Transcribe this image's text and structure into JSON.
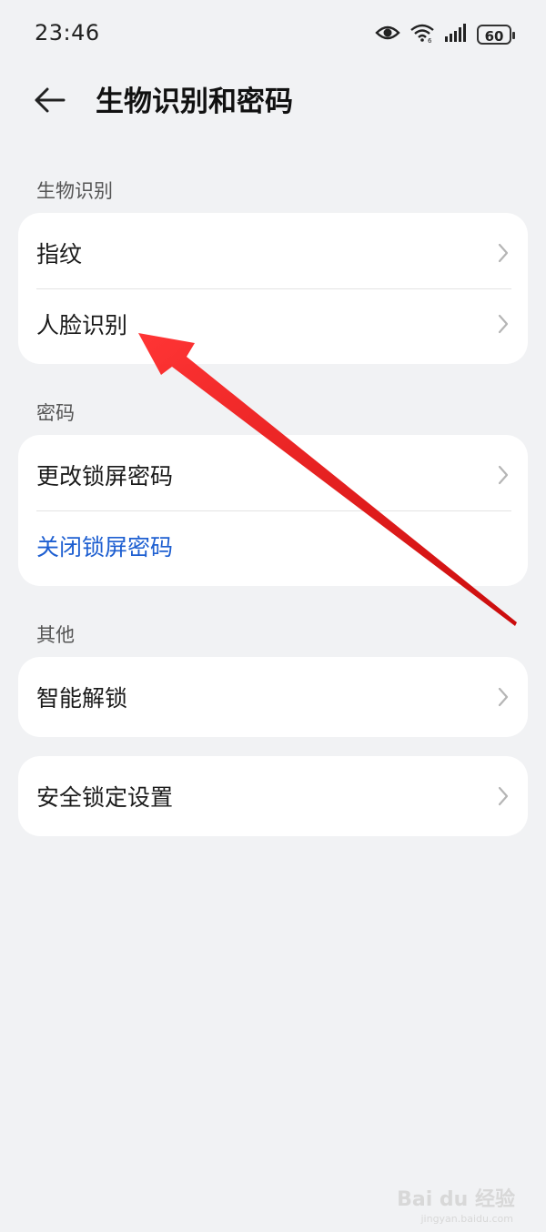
{
  "status_bar": {
    "time": "23:46",
    "battery": "60",
    "icons": [
      "eye-icon",
      "wifi-icon",
      "signal-icon",
      "battery-icon"
    ]
  },
  "header": {
    "title": "生物识别和密码",
    "back_icon": "arrow-left-icon"
  },
  "sections": {
    "biometrics": {
      "label": "生物识别",
      "items": [
        {
          "label": "指纹"
        },
        {
          "label": "人脸识别"
        }
      ]
    },
    "password": {
      "label": "密码",
      "items": [
        {
          "label": "更改锁屏密码"
        },
        {
          "label": "关闭锁屏密码"
        }
      ]
    },
    "other": {
      "label": "其他",
      "items": [
        {
          "label": "智能解锁"
        }
      ]
    },
    "security_lock": {
      "items": [
        {
          "label": "安全锁定设置"
        }
      ]
    }
  },
  "watermark": {
    "text": "Bai du 经验",
    "sub": "jingyan.baidu.com"
  },
  "colors": {
    "background": "#f1f2f4",
    "card": "#ffffff",
    "link_blue": "#1e5fd1",
    "annotation_arrow": "#e8141a"
  }
}
